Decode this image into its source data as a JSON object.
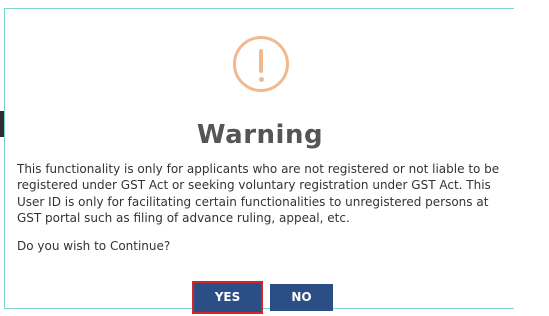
{
  "dialog": {
    "title": "Warning",
    "message": "This functionality is only for applicants who are not registered or not liable to be registered under GST Act or seeking voluntary registration under GST Act. This User ID is only for facilitating certain functionalities to unregistered persons at GST portal such as filing of advance ruling, appeal, etc.",
    "question": "Do you wish to Continue?",
    "yes_label": "YES",
    "no_label": "NO",
    "icon": "warning-exclamation-icon"
  },
  "colors": {
    "accent_border": "#7dd6cc",
    "warning_icon": "#f2b98f",
    "button": "#2c4e86",
    "focus_outline": "#d3262b"
  }
}
